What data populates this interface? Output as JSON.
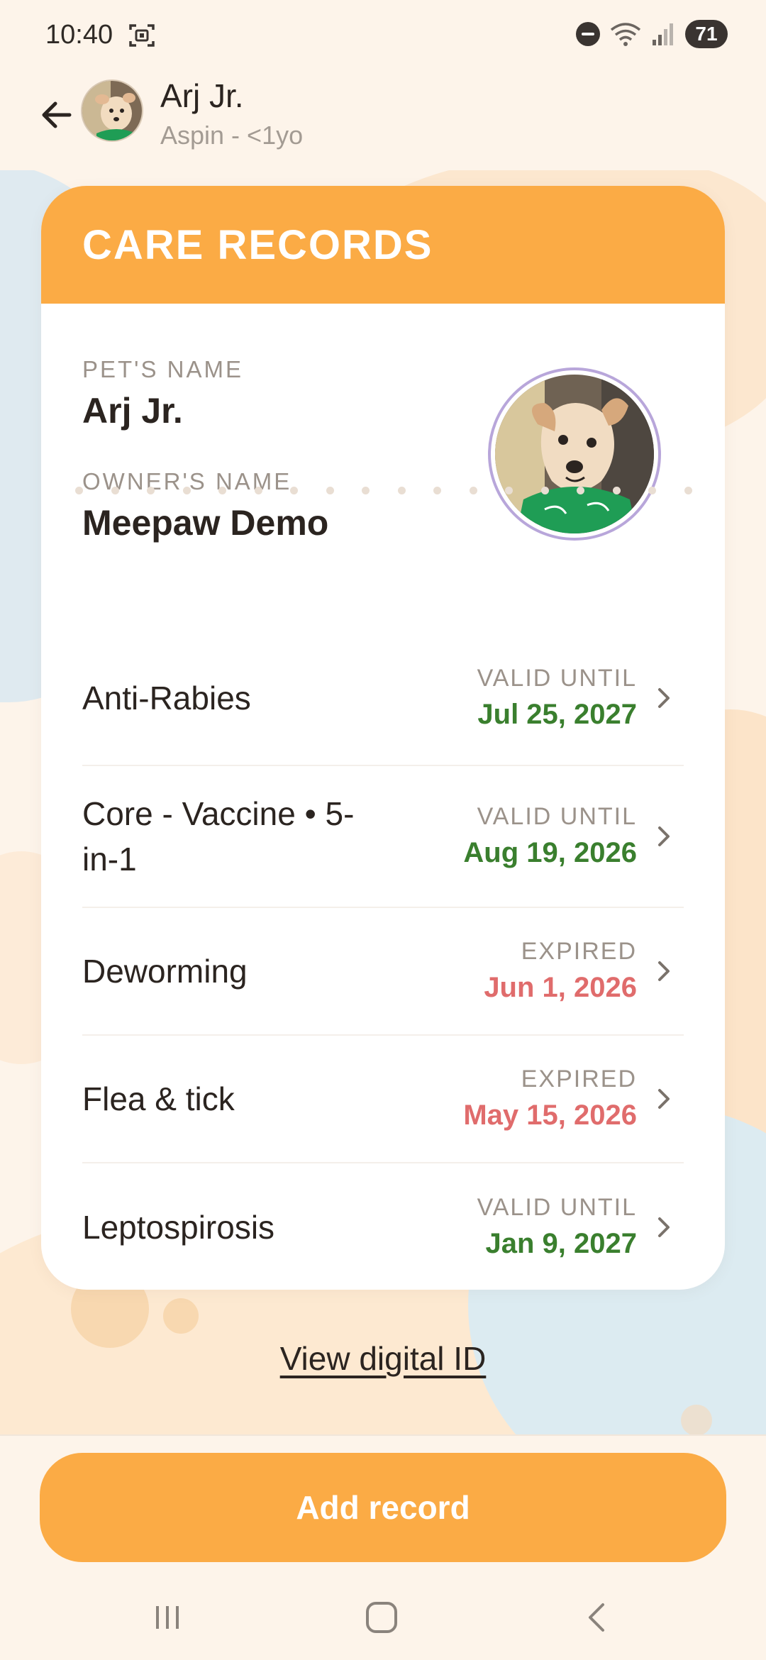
{
  "status_bar": {
    "time": "10:40",
    "battery": "71",
    "icons": [
      "screenshot-icon",
      "do-not-disturb-icon",
      "wifi-icon",
      "signal-icon",
      "battery-icon"
    ]
  },
  "header": {
    "pet_name": "Arj Jr.",
    "pet_subtitle": "Aspin - <1yo",
    "back_icon": "arrow-left-icon"
  },
  "card": {
    "title": "CARE RECORDS",
    "pet_name_label": "PET'S NAME",
    "pet_name": "Arj Jr.",
    "owner_name_label": "OWNER'S NAME",
    "owner_name": "Meepaw Demo"
  },
  "records": [
    {
      "name": "Anti-Rabies",
      "status_label": "VALID UNTIL",
      "date": "Jul 25, 2027",
      "status": "valid"
    },
    {
      "name": "Core - Vaccine • 5-in-1",
      "status_label": "VALID UNTIL",
      "date": "Aug 19, 2026",
      "status": "valid"
    },
    {
      "name": "Deworming",
      "status_label": "EXPIRED",
      "date": "Jun 1, 2026",
      "status": "expired"
    },
    {
      "name": "Flea & tick",
      "status_label": "EXPIRED",
      "date": "May 15, 2026",
      "status": "expired"
    },
    {
      "name": "Leptospirosis",
      "status_label": "VALID UNTIL",
      "date": "Jan 9, 2027",
      "status": "valid"
    }
  ],
  "links": {
    "view_digital_id": "View digital ID"
  },
  "actions": {
    "add_record": "Add record"
  },
  "colors": {
    "accent_orange": "#fbab45",
    "valid_green": "#3a7f2e",
    "expired_red": "#e06c6c",
    "background": "#fdf4ea"
  },
  "nav_bar": {
    "icons": [
      "recent-apps-icon",
      "home-icon",
      "back-icon"
    ]
  }
}
